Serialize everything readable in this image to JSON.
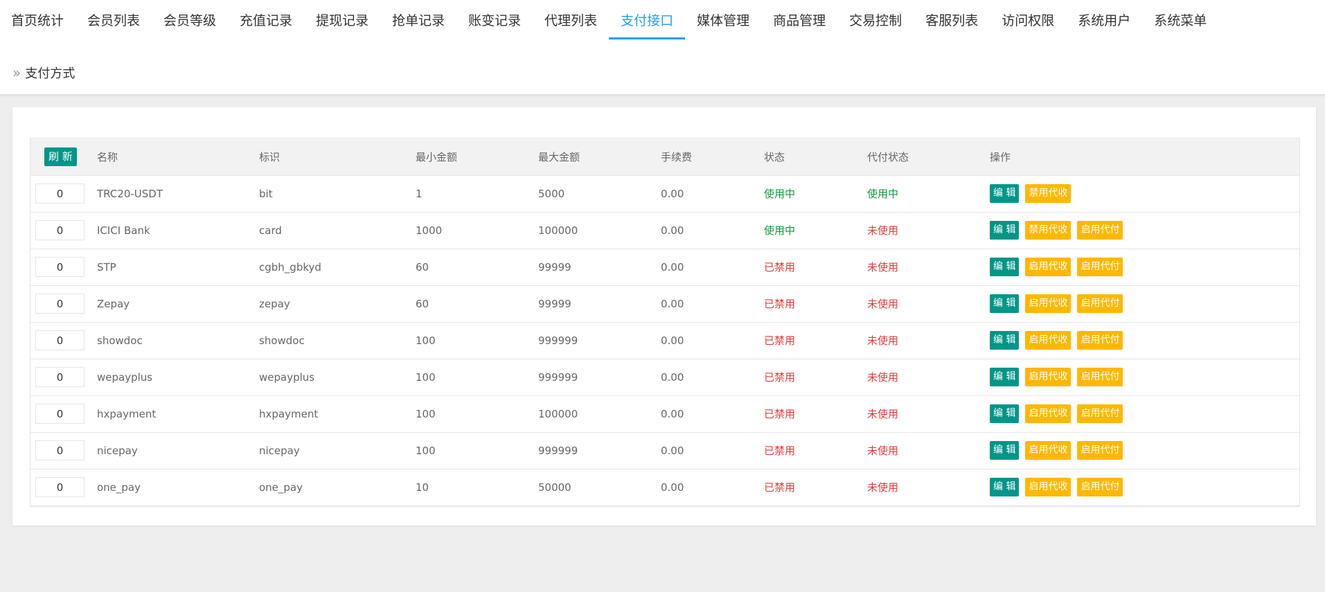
{
  "nav": {
    "items": [
      "首页统计",
      "会员列表",
      "会员等级",
      "充值记录",
      "提现记录",
      "抢单记录",
      "账变记录",
      "代理列表",
      "支付接口",
      "媒体管理",
      "商品管理",
      "交易控制",
      "客服列表",
      "访问权限",
      "系统用户",
      "系统菜单"
    ],
    "active_index": 8
  },
  "breadcrumb": {
    "icon": "double-chevron-right-icon",
    "label": "支付方式"
  },
  "table": {
    "refresh_label": "刷 新",
    "headers": [
      "名称",
      "标识",
      "最小金额",
      "最大金额",
      "手续费",
      "状态",
      "代付状态",
      "操作"
    ],
    "rows": [
      {
        "sort": "0",
        "name": "TRC20-USDT",
        "code": "bit",
        "min": "1",
        "max": "5000",
        "fee": "0.00",
        "status": "使用中",
        "payout_status": "使用中",
        "status_on": true,
        "payout_on": true,
        "actions": [
          "编 辑",
          "禁用代收"
        ]
      },
      {
        "sort": "0",
        "name": "ICICI Bank",
        "code": "card",
        "min": "1000",
        "max": "100000",
        "fee": "0.00",
        "status": "使用中",
        "payout_status": "未使用",
        "status_on": true,
        "payout_on": false,
        "actions": [
          "编 辑",
          "禁用代收",
          "启用代付"
        ]
      },
      {
        "sort": "0",
        "name": "STP",
        "code": "cgbh_gbkyd",
        "min": "60",
        "max": "99999",
        "fee": "0.00",
        "status": "已禁用",
        "payout_status": "未使用",
        "status_on": false,
        "payout_on": false,
        "actions": [
          "编 辑",
          "启用代收",
          "启用代付"
        ]
      },
      {
        "sort": "0",
        "name": "Zepay",
        "code": "zepay",
        "min": "60",
        "max": "99999",
        "fee": "0.00",
        "status": "已禁用",
        "payout_status": "未使用",
        "status_on": false,
        "payout_on": false,
        "actions": [
          "编 辑",
          "启用代收",
          "启用代付"
        ]
      },
      {
        "sort": "0",
        "name": "showdoc",
        "code": "showdoc",
        "min": "100",
        "max": "999999",
        "fee": "0.00",
        "status": "已禁用",
        "payout_status": "未使用",
        "status_on": false,
        "payout_on": false,
        "actions": [
          "编 辑",
          "启用代收",
          "启用代付"
        ]
      },
      {
        "sort": "0",
        "name": "wepayplus",
        "code": "wepayplus",
        "min": "100",
        "max": "999999",
        "fee": "0.00",
        "status": "已禁用",
        "payout_status": "未使用",
        "status_on": false,
        "payout_on": false,
        "actions": [
          "编 辑",
          "启用代收",
          "启用代付"
        ]
      },
      {
        "sort": "0",
        "name": "hxpayment",
        "code": "hxpayment",
        "min": "100",
        "max": "100000",
        "fee": "0.00",
        "status": "已禁用",
        "payout_status": "未使用",
        "status_on": false,
        "payout_on": false,
        "actions": [
          "编 辑",
          "启用代收",
          "启用代付"
        ]
      },
      {
        "sort": "0",
        "name": "nicepay",
        "code": "nicepay",
        "min": "100",
        "max": "999999",
        "fee": "0.00",
        "status": "已禁用",
        "payout_status": "未使用",
        "status_on": false,
        "payout_on": false,
        "actions": [
          "编 辑",
          "启用代收",
          "启用代付"
        ]
      },
      {
        "sort": "0",
        "name": "one_pay",
        "code": "one_pay",
        "min": "10",
        "max": "50000",
        "fee": "0.00",
        "status": "已禁用",
        "payout_status": "未使用",
        "status_on": false,
        "payout_on": false,
        "actions": [
          "编 辑",
          "启用代收",
          "启用代付"
        ]
      }
    ]
  },
  "colors": {
    "primary": "#009688",
    "warn": "#FFB800",
    "active_tab": "#1E9FFF",
    "status_on": "#109a3c",
    "status_off": "#e23b3b"
  }
}
